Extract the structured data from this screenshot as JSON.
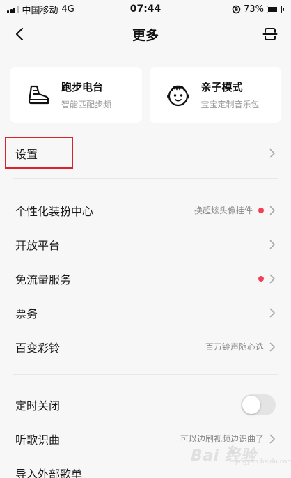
{
  "status_bar": {
    "carrier": "中国移动",
    "network": "4G",
    "time": "07:44",
    "battery": "73%",
    "battery_level": 0.73
  },
  "nav": {
    "title": "更多"
  },
  "cards": [
    {
      "title": "跑步电台",
      "subtitle": "智能匹配步频",
      "icon": "running-shoe-icon"
    },
    {
      "title": "亲子模式",
      "subtitle": "宝宝定制音乐包",
      "icon": "baby-face-icon"
    }
  ],
  "settings": {
    "label": "设置"
  },
  "menu": [
    {
      "label": "个性化装扮中心",
      "hint": "换超炫头像挂件",
      "dot": true
    },
    {
      "label": "开放平台",
      "hint": "",
      "dot": false
    },
    {
      "label": "免流量服务",
      "hint": "",
      "dot": true
    },
    {
      "label": "票务",
      "hint": "",
      "dot": false
    },
    {
      "label": "百变彩铃",
      "hint": "百万铃声随心选",
      "dot": false
    }
  ],
  "tools": [
    {
      "label": "定时关闭",
      "type": "toggle",
      "on": false
    },
    {
      "label": "听歌识曲",
      "hint": "可以边刷视频边识曲了"
    },
    {
      "label": "导入外部歌单"
    }
  ],
  "watermark": {
    "text": "Bai 经验",
    "small": "jingyan.baidu.com"
  },
  "colors": {
    "background": "#f7f7f7",
    "card": "#ffffff",
    "dot": "#f2405a",
    "highlight": "#d9232e"
  }
}
